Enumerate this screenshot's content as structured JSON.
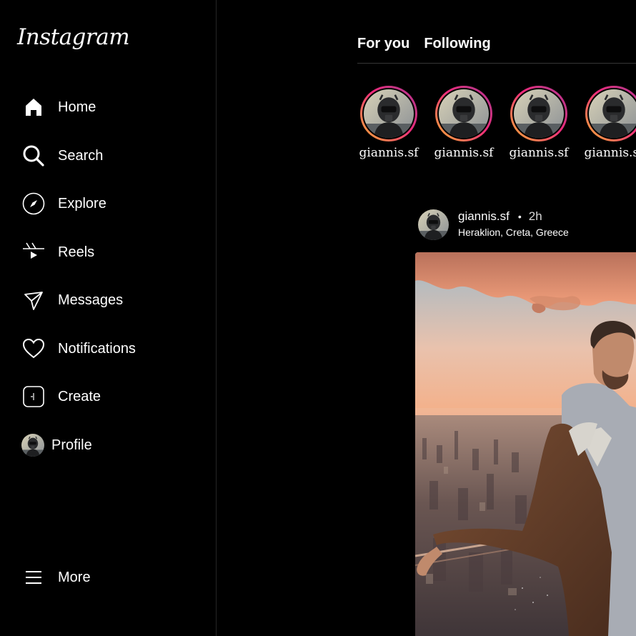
{
  "app": {
    "logo_text": "Instagram"
  },
  "sidebar": {
    "items": [
      {
        "label": "Home",
        "icon": "home-icon"
      },
      {
        "label": "Search",
        "icon": "search-icon"
      },
      {
        "label": "Explore",
        "icon": "compass-icon"
      },
      {
        "label": "Reels",
        "icon": "reels-icon"
      },
      {
        "label": "Messages",
        "icon": "paper-plane-icon"
      },
      {
        "label": "Notifications",
        "icon": "heart-icon"
      },
      {
        "label": "Create",
        "icon": "plus-square-icon"
      },
      {
        "label": "Profile",
        "icon": "avatar"
      }
    ],
    "more_label": "More"
  },
  "feed": {
    "tabs": [
      {
        "label": "For you"
      },
      {
        "label": "Following"
      }
    ],
    "stories": [
      {
        "username": "giannis.sf"
      },
      {
        "username": "giannis.sf"
      },
      {
        "username": "giannis.sf"
      },
      {
        "username": "giannis.sf"
      }
    ],
    "post": {
      "username": "giannis.sf",
      "separator": "•",
      "time": "2h",
      "location": "Heraklion, Creta, Greece"
    }
  },
  "colors": {
    "background": "#000000",
    "divider": "#262626",
    "story_ring_start": "#f9b234",
    "story_ring_end": "#d6249f"
  }
}
